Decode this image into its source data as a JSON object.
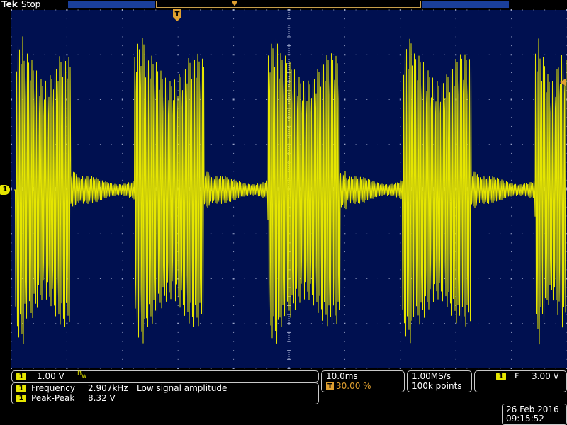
{
  "header": {
    "brand": "Tek",
    "status": "Stop"
  },
  "trigger_marker": "T",
  "channel_marker": "1",
  "channel": {
    "id": "1",
    "scale": "1.00 V",
    "bw_icon": "bandwidth-limit-icon"
  },
  "measurements": [
    {
      "ch": "1",
      "name": "Frequency",
      "value": "2.907kHz",
      "note": "Low signal amplitude"
    },
    {
      "ch": "1",
      "name": "Peak-Peak",
      "value": "8.32 V",
      "note": ""
    }
  ],
  "timebase": {
    "scale": "10.0ms",
    "trigger_pos": "30.00 %"
  },
  "acquisition": {
    "rate": "1.00MS/s",
    "points": "100k points"
  },
  "trigger": {
    "ch": "1",
    "slope": "rising-edge-icon",
    "level": "3.00 V"
  },
  "datetime": {
    "date": "26 Feb  2016",
    "time": "09:15:52"
  },
  "colors": {
    "trace": "#e6e600",
    "background": "#001050",
    "grid": "#9aa4c8",
    "accent": "#e0a030"
  }
}
